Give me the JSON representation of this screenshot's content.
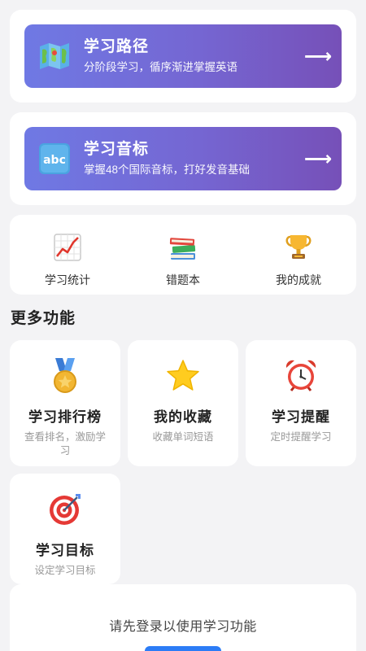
{
  "path_banner": {
    "title": "学习路径",
    "subtitle": "分阶段学习，循序渐进掌握英语",
    "icon": "map-icon",
    "arrow": "⟶"
  },
  "phonetics_banner": {
    "title": "学习音标",
    "subtitle": "掌握48个国际音标，打好发音基础",
    "icon": "abc-icon",
    "arrow": "⟶"
  },
  "tools": [
    {
      "label": "学习统计",
      "icon": "chart-icon"
    },
    {
      "label": "错题本",
      "icon": "books-icon"
    },
    {
      "label": "我的成就",
      "icon": "trophy-icon"
    }
  ],
  "more_section": {
    "title": "更多功能"
  },
  "features": [
    {
      "title": "学习排行榜",
      "subtitle": "查看排名，激励学习",
      "icon": "medal-icon"
    },
    {
      "title": "我的收藏",
      "subtitle": "收藏单词短语",
      "icon": "star-icon"
    },
    {
      "title": "学习提醒",
      "subtitle": "定时提醒学习",
      "icon": "alarm-clock-icon"
    },
    {
      "title": "学习目标",
      "subtitle": "设定学习目标",
      "icon": "target-icon"
    }
  ],
  "login": {
    "prompt": "请先登录以使用学习功能",
    "button_label": ""
  },
  "colors": {
    "banner_start": "#6f79e4",
    "banner_end": "#7650b8",
    "accent_blue": "#2c7cf6",
    "background": "#f3f3f5"
  }
}
